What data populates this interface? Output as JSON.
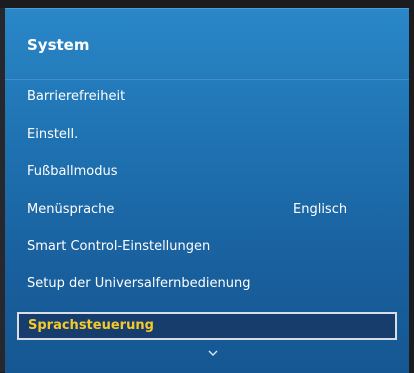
{
  "panel": {
    "title": "System"
  },
  "menu": {
    "items": [
      {
        "label": "Barrierefreiheit",
        "value": ""
      },
      {
        "label": "Einstell.",
        "value": ""
      },
      {
        "label": "Fußballmodus",
        "value": ""
      },
      {
        "label": "Menüsprache",
        "value": "Englisch"
      },
      {
        "label": "Smart Control-Einstellungen",
        "value": ""
      },
      {
        "label": "Setup der Universalfernbedienung",
        "value": ""
      },
      {
        "label": "Sprachsteuerung",
        "value": "",
        "selected": true
      }
    ]
  },
  "icons": {
    "scroll_down": "chevron-down-icon"
  },
  "colors": {
    "panel_top": "#2a87c8",
    "panel_bottom": "#155792",
    "selected_text": "#f5c92a",
    "selected_bg": "#173d6d",
    "selected_border": "#d8dde6",
    "text": "#ffffff"
  }
}
